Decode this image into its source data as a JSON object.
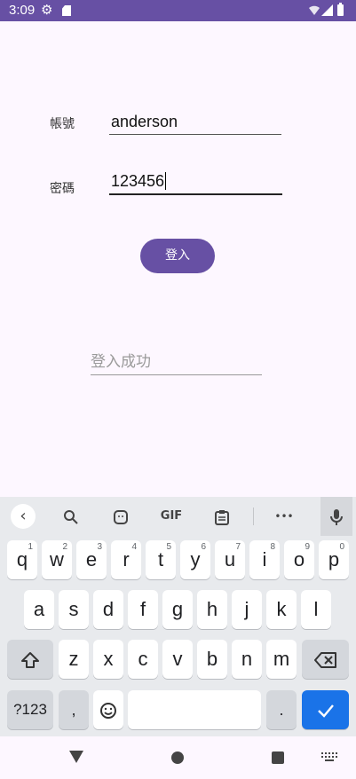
{
  "status_bar": {
    "time": "3:09",
    "icons": [
      "gear-icon",
      "sd-card-icon",
      "wifi-icon",
      "signal-icon",
      "battery-icon"
    ]
  },
  "form": {
    "account_label": "帳號",
    "account_value": "anderson",
    "password_label": "密碼",
    "password_value": "123456",
    "login_button": "登入",
    "result_text": "登入成功"
  },
  "keyboard": {
    "toolbar": {
      "gif_label": "GIF",
      "more_label": "•••"
    },
    "row1": [
      {
        "key": "q",
        "hint": "1"
      },
      {
        "key": "w",
        "hint": "2"
      },
      {
        "key": "e",
        "hint": "3"
      },
      {
        "key": "r",
        "hint": "4"
      },
      {
        "key": "t",
        "hint": "5"
      },
      {
        "key": "y",
        "hint": "6"
      },
      {
        "key": "u",
        "hint": "7"
      },
      {
        "key": "i",
        "hint": "8"
      },
      {
        "key": "o",
        "hint": "9"
      },
      {
        "key": "p",
        "hint": "0"
      }
    ],
    "row2": [
      "a",
      "s",
      "d",
      "f",
      "g",
      "h",
      "j",
      "k",
      "l"
    ],
    "row3": [
      "z",
      "x",
      "c",
      "v",
      "b",
      "n",
      "m"
    ],
    "symbols_label": "?123",
    "comma": ",",
    "period": "."
  },
  "colors": {
    "accent": "#6750a4",
    "enter_key": "#1a73e8",
    "background": "#fdf7ff",
    "keyboard_bg": "#e8eaed"
  }
}
